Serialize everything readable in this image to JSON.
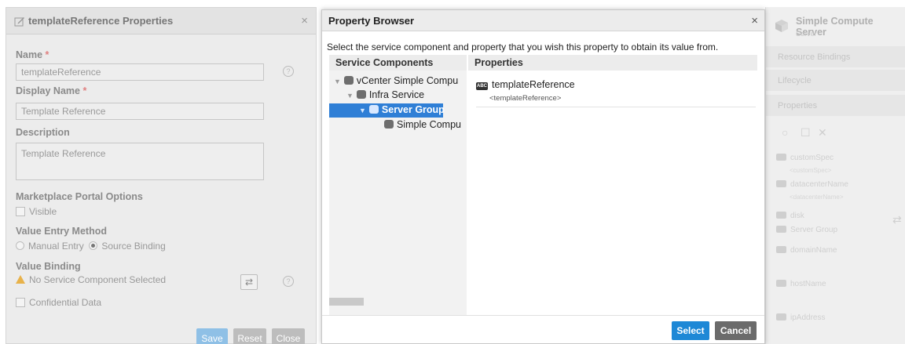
{
  "left_panel": {
    "title": "templateReference Properties",
    "close": "×",
    "name_label": "Name",
    "name_value": "templateReference",
    "display_name_label": "Display Name",
    "display_name_value": "Template Reference",
    "description_label": "Description",
    "description_value": "Template Reference",
    "marketplace_label": "Marketplace Portal Options",
    "visible_label": "Visible",
    "value_entry_label": "Value Entry Method",
    "manual_entry_label": "Manual Entry",
    "source_binding_label": "Source Binding",
    "value_binding_label": "Value Binding",
    "no_component_text": "No Service Component Selected",
    "confidential_label": "Confidential Data",
    "required_mark": "*",
    "buttons": {
      "save": "Save",
      "reset": "Reset",
      "close": "Close"
    },
    "colors": {
      "save": "#8fc0e6",
      "reset": "#bdbdbd",
      "close": "#bdbdbd"
    }
  },
  "dialog": {
    "title": "Property Browser",
    "close": "×",
    "instructions": "Select the service component and property that you wish this property to obtain its value from.",
    "col_components": "Service Components",
    "col_properties": "Properties",
    "tree": [
      {
        "label": "vCenter Simple Compu",
        "icon": "stack-icon",
        "expanded": true,
        "selected": false
      },
      {
        "label": "Infra Service",
        "icon": "service-icon",
        "expanded": true,
        "selected": false
      },
      {
        "label": "Server Group",
        "icon": "server-group-icon",
        "expanded": true,
        "selected": true
      },
      {
        "label": "Simple Compu",
        "icon": "cube-icon",
        "expanded": false,
        "selected": false
      }
    ],
    "property": {
      "badge": "ABC",
      "name": "templateReference",
      "variable": "<templateReference>"
    },
    "buttons": {
      "select": "Select",
      "cancel": "Cancel"
    },
    "colors": {
      "accent": "#2f7fd6",
      "select": "#1e88d6",
      "cancel": "#6b6b6b"
    }
  },
  "right_panel": {
    "title": "Simple Compute Server",
    "subtitle": "Server",
    "sections": [
      "Resource Bindings",
      "Lifecycle",
      "Properties"
    ],
    "items": [
      {
        "name": "customSpec",
        "var": "<customSpec>"
      },
      {
        "name": "datacenterName",
        "var": "<datacenterName>"
      },
      {
        "name": "disk",
        "var": ""
      },
      {
        "name": "Server Group",
        "var": ""
      },
      {
        "name": "domainName",
        "var": ""
      },
      {
        "name": "hostName",
        "var": ""
      },
      {
        "name": "ipAddress",
        "var": ""
      }
    ]
  }
}
